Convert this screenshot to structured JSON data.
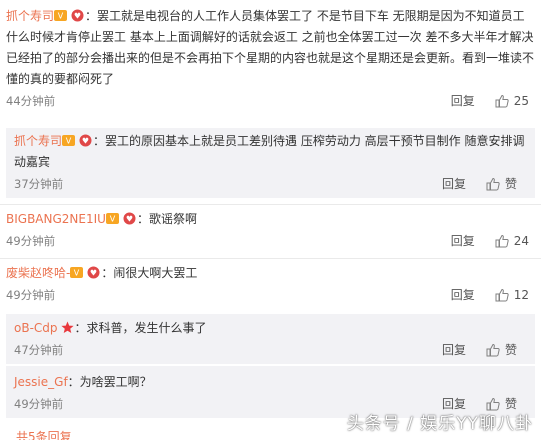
{
  "comments": [
    {
      "user": "抓个寿司",
      "text": "：罢工就是电视台的人工作人员集体罢工了 不是节目下车 无限期是因为不知道员工什么时候才肯停止罢工 基本上上面调解好的话就会返工 之前也全体罢工过一次 差不多大半年才解决 已经拍了的部分会播出来的但是不会再拍下个星期的内容也就是这个星期还是会更新。看到一堆读不懂的真的要都闷死了",
      "time": "44分钟前",
      "reply": "回复",
      "likes": "25"
    },
    {
      "user": "抓个寿司",
      "text": "：罢工的原因基本上就是员工差别待遇 压榨劳动力 高层干预节目制作 随意安排调动嘉宾",
      "time": "37分钟前",
      "reply": "回复",
      "likes": "赞"
    },
    {
      "user": "BIGBANG2NE1IU",
      "text": "：歌谣祭啊",
      "time": "49分钟前",
      "reply": "回复",
      "likes": "24"
    },
    {
      "user": "废柴赵咚哈-",
      "text": "：闹很大啊大罢工",
      "time": "49分钟前",
      "reply": "回复",
      "likes": "12"
    },
    {
      "user": "oB-Cdp",
      "text": "：求科普，发生什么事了",
      "time": "47分钟前",
      "reply": "回复",
      "likes": "赞"
    },
    {
      "user": "Jessie_Gf",
      "text": "：为啥罢工啊？",
      "time": "49分钟前",
      "reply": "回复",
      "likes": "赞"
    }
  ],
  "footer_link": "共5条回复",
  "watermark": "头条号 / 娱乐YY聊八卦",
  "colors": {
    "username": "#eb7350",
    "reply_bg": "#f2f2f5",
    "meta": "#808080"
  }
}
